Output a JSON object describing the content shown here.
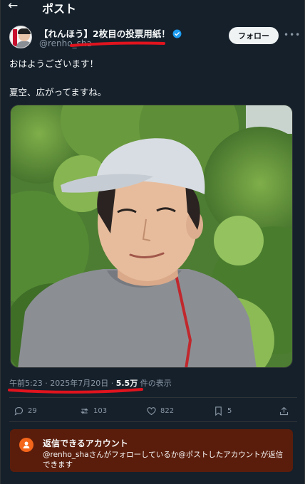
{
  "header": {
    "title": "ポスト"
  },
  "author": {
    "display_name": "【れんほう】2枚目の投票用紙！",
    "handle": "@renho_sha",
    "follow_label": "フォロー"
  },
  "post": {
    "lines": [
      "おはようございます！",
      "夏空、広がってますね。"
    ]
  },
  "meta": {
    "time": "午前5:23",
    "sep1": " · ",
    "date": "2025年7月20日",
    "sep2": " · ",
    "views": "5.5万",
    "views_suffix": " 件の表示"
  },
  "actions": {
    "replies": "29",
    "reposts": "103",
    "likes": "822",
    "bookmarks": "5"
  },
  "notice": {
    "title": "返信できるアカウント",
    "body": "@renho_shaさんがフォローしているか@ポストしたアカウントが返信できます"
  },
  "colors": {
    "background": "#15202b",
    "accent_verified": "#1d9bf0",
    "annotation_red": "#e0141e",
    "notice_bg": "#5b1d0b",
    "notice_icon": "#f4661b"
  },
  "icons": [
    "back-arrow-icon",
    "verified-badge-icon",
    "more-icon",
    "reply-icon",
    "repost-icon",
    "like-icon",
    "bookmark-icon",
    "share-icon",
    "person-icon"
  ]
}
